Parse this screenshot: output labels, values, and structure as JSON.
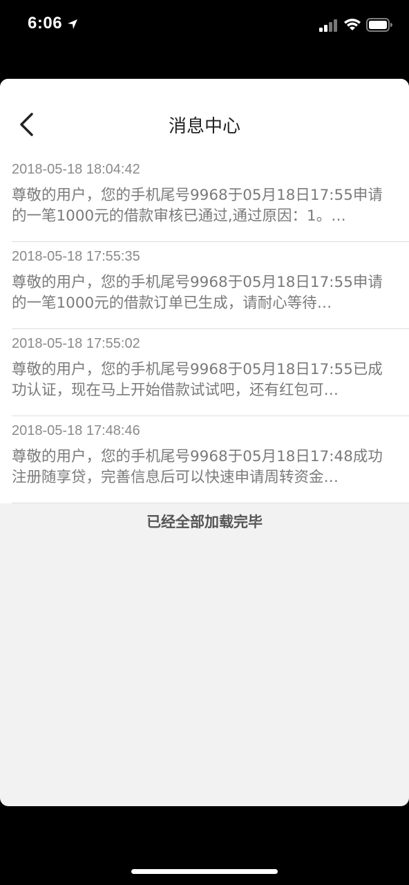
{
  "status_bar": {
    "time": "6:06",
    "location_icon": "location-arrow-icon",
    "signal_icon": "cellular-signal-icon",
    "wifi_icon": "wifi-icon",
    "battery_icon": "battery-icon"
  },
  "header": {
    "title": "消息中心",
    "back_icon": "chevron-left-icon"
  },
  "messages": [
    {
      "time": "2018-05-18 18:04:42",
      "body": "尊敬的用户，您的手机尾号9968于05月18日17:55申请的一笔1000元的借款审核已通过,通过原因：1。…"
    },
    {
      "time": "2018-05-18 17:55:35",
      "body": "尊敬的用户，您的手机尾号9968于05月18日17:55申请的一笔1000元的借款订单已生成，请耐心等待…"
    },
    {
      "time": "2018-05-18 17:55:02",
      "body": "尊敬的用户，您的手机尾号9968于05月18日17:55已成功认证，现在马上开始借款试试吧，还有红包可…"
    },
    {
      "time": "2018-05-18 17:48:46",
      "body": "尊敬的用户，您的手机尾号9968于05月18日17:48成功注册随享贷，完善信息后可以快速申请周转资金…"
    }
  ],
  "footer": {
    "load_complete": "已经全部加载完毕"
  },
  "colors": {
    "background": "#000000",
    "sheet_background": "#f2f2f2",
    "card_background": "#ffffff",
    "secondary_text": "#8a8a8a"
  }
}
